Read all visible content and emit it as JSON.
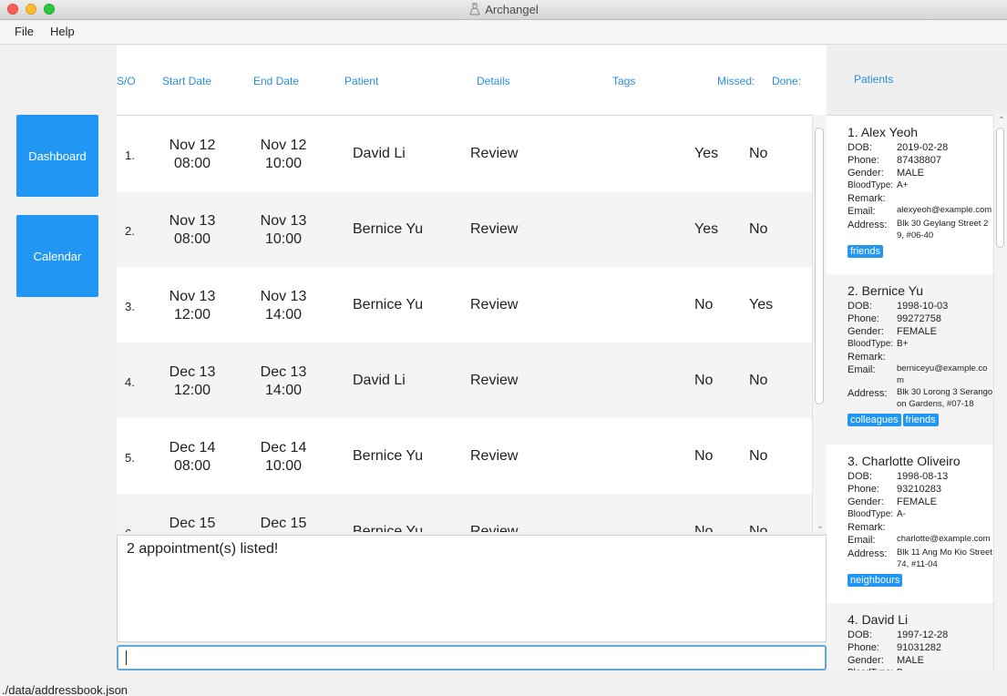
{
  "window": {
    "title": "Archangel"
  },
  "menu": {
    "file": "File",
    "help": "Help"
  },
  "nav": {
    "dashboard": "Dashboard",
    "calendar": "Calendar"
  },
  "columns": {
    "sn": "S/O",
    "start": "Start Date",
    "end": "End Date",
    "patient": "Patient",
    "details": "Details",
    "tags": "Tags",
    "missed": "Missed:",
    "done": "Done:"
  },
  "appointments": [
    {
      "sn": "1.",
      "start_date": "Nov 12",
      "start_time": "08:00",
      "end_date": "Nov 12",
      "end_time": "10:00",
      "patient": "David Li",
      "details": "Review",
      "missed": "Yes",
      "done": "No"
    },
    {
      "sn": "2.",
      "start_date": "Nov 13",
      "start_time": "08:00",
      "end_date": "Nov 13",
      "end_time": "10:00",
      "patient": "Bernice Yu",
      "details": "Review",
      "missed": "Yes",
      "done": "No"
    },
    {
      "sn": "3.",
      "start_date": "Nov 13",
      "start_time": "12:00",
      "end_date": "Nov 13",
      "end_time": "14:00",
      "patient": "Bernice Yu",
      "details": "Review",
      "missed": "No",
      "done": "Yes"
    },
    {
      "sn": "4.",
      "start_date": "Dec 13",
      "start_time": "12:00",
      "end_date": "Dec 13",
      "end_time": "14:00",
      "patient": "David Li",
      "details": "Review",
      "missed": "No",
      "done": "No"
    },
    {
      "sn": "5.",
      "start_date": "Dec 14",
      "start_time": "08:00",
      "end_date": "Dec 14",
      "end_time": "10:00",
      "patient": "Bernice Yu",
      "details": "Review",
      "missed": "No",
      "done": "No"
    },
    {
      "sn": "6.",
      "start_date": "Dec 15",
      "start_time": "",
      "end_date": "Dec 15",
      "end_time": "",
      "patient": "Bernice Yu",
      "details": "Review",
      "missed": "No",
      "done": "No"
    }
  ],
  "result": {
    "message": "2 appointment(s) listed!"
  },
  "command": {
    "value": ""
  },
  "status": {
    "path": "./data/addressbook.json"
  },
  "patients_panel": {
    "title": "Patients",
    "labels": {
      "dob": "DOB:",
      "phone": "Phone:",
      "gender": "Gender:",
      "blood": "BloodType:",
      "remark": "Remark:",
      "email": "Email:",
      "address": "Address:"
    },
    "patients": [
      {
        "name": "1. Alex Yeoh",
        "dob": "2019-02-28",
        "phone": "87438807",
        "gender": "MALE",
        "blood": "A+",
        "remark": "",
        "email": "alexyeoh@example.com",
        "address": "Blk 30 Geylang Street 29, #06-40",
        "tags": [
          "friends"
        ]
      },
      {
        "name": "2. Bernice Yu",
        "dob": "1998-10-03",
        "phone": "99272758",
        "gender": "FEMALE",
        "blood": "B+",
        "remark": "",
        "email": "berniceyu@example.com",
        "address": "Blk 30 Lorong 3 Serangoon Gardens, #07-18",
        "tags": [
          "colleagues",
          "friends"
        ]
      },
      {
        "name": "3. Charlotte Oliveiro",
        "dob": "1998-08-13",
        "phone": "93210283",
        "gender": "FEMALE",
        "blood": "A-",
        "remark": "",
        "email": "charlotte@example.com",
        "address": "Blk 11 Ang Mo Kio Street 74, #11-04",
        "tags": [
          "neighbours"
        ]
      },
      {
        "name": "4. David Li",
        "dob": "1997-12-28",
        "phone": "91031282",
        "gender": "MALE",
        "blood": "B-",
        "remark": "",
        "email": "",
        "address": "",
        "tags": []
      }
    ]
  }
}
